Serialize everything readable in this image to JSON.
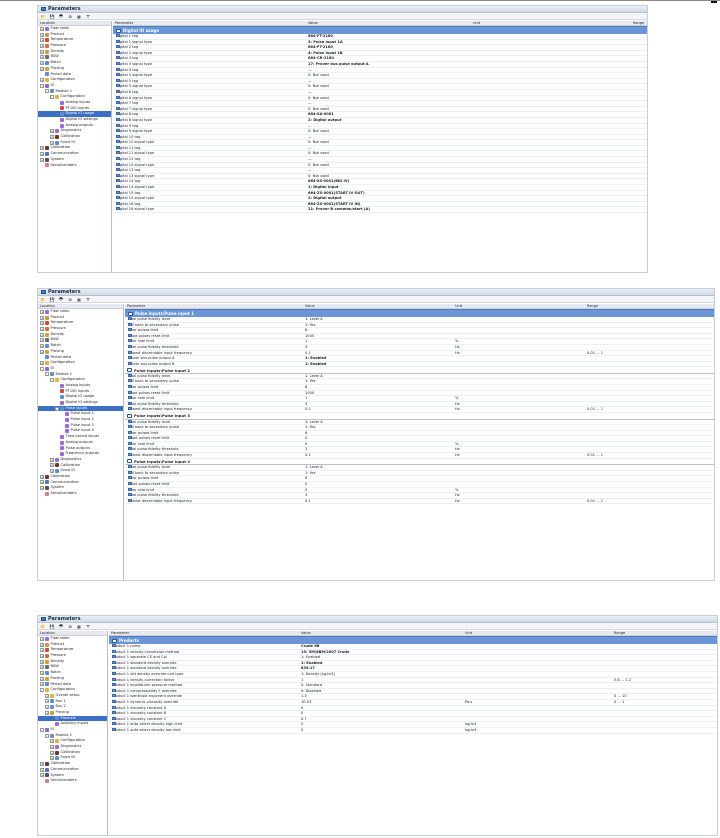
{
  "title": "Parameters",
  "left_header": "Location",
  "columns": {
    "parameter": "Parameter",
    "value": "Value",
    "unit": "Unit",
    "range": "Range"
  },
  "panel1": {
    "tree": [
      {
        "label": "Flow rates",
        "exp": "+",
        "color": "#9c6bd6"
      },
      {
        "label": "Product",
        "exp": "+",
        "color": "#c99a3d"
      },
      {
        "label": "Temperature",
        "exp": "+",
        "color": "#d04a3a"
      },
      {
        "label": "Pressure",
        "exp": "+",
        "color": "#d0703a"
      },
      {
        "label": "Density",
        "exp": "+",
        "color": "#c9a23d"
      },
      {
        "label": "BSW",
        "exp": "+",
        "color": "#6a6a6a"
      },
      {
        "label": "Batch",
        "exp": "+",
        "color": "#5b8fd0"
      },
      {
        "label": "Proving",
        "exp": "+",
        "color": "#c9a23d"
      },
      {
        "label": "Period data",
        "exp": "",
        "color": "#5b8fd0"
      },
      {
        "label": "Configuration",
        "exp": "+",
        "color": "#e0b040"
      },
      {
        "label": "IO",
        "exp": "-",
        "color": "#8b6bc9"
      },
      {
        "label": "Module 1",
        "exp": "-",
        "color": "#6b8fb0"
      },
      {
        "label": "Configuration",
        "exp": "-",
        "color": "#e0b040"
      },
      {
        "label": "Analog inputs",
        "exp": "",
        "color": "#9c6bd6"
      },
      {
        "label": "PT100 inputs",
        "exp": "",
        "color": "#d04a3a"
      },
      {
        "label": "Digital IO usage",
        "exp": "",
        "color": "#5b8fd0",
        "sel": true
      },
      {
        "label": "Digital IO settings",
        "exp": "",
        "color": "#9c6bd6"
      },
      {
        "label": "Analog outputs",
        "exp": "",
        "color": "#9c6bd6"
      },
      {
        "label": "Diagnostics",
        "exp": "+",
        "color": "#9c6bd6"
      },
      {
        "label": "Calibration",
        "exp": "+",
        "color": "#6a3a2a"
      },
      {
        "label": "Force IO",
        "exp": "+",
        "color": "#5b8fd0"
      },
      {
        "label": "Calibration",
        "exp": "+",
        "color": "#6a3a2a"
      },
      {
        "label": "Communication",
        "exp": "+",
        "color": "#4a7ab8"
      },
      {
        "label": "System",
        "exp": "+",
        "color": "#555"
      },
      {
        "label": "Serialnumbers",
        "exp": "",
        "color": "#d08080"
      }
    ],
    "section": "Digital IO usage",
    "rows": [
      {
        "p": "Digital 1 tag",
        "v": "664-FT-2180",
        "b": true
      },
      {
        "p": "Digital 1 signal type",
        "v": "3: Pulse input 1A",
        "b": true
      },
      {
        "p": "Digital 2 tag",
        "v": "664-FT-2180",
        "b": true
      },
      {
        "p": "Digital 2 signal type",
        "v": "4: Pulse input 1B",
        "b": true
      },
      {
        "p": "Digital 3 tag",
        "v": "664-CR-2180",
        "b": true
      },
      {
        "p": "Digital 3 signal type",
        "v": "17: Prover bus pulse output A",
        "b": true
      },
      {
        "p": "Digital 4 tag",
        "v": "—",
        "b": false
      },
      {
        "p": "Digital 4 signal type",
        "v": "0: Not used",
        "b": false
      },
      {
        "p": "Digital 5 tag",
        "v": "—",
        "b": false
      },
      {
        "p": "Digital 5 signal type",
        "v": "0: Not used",
        "b": false
      },
      {
        "p": "Digital 6 tag",
        "v": "—",
        "b": false
      },
      {
        "p": "Digital 6 signal type",
        "v": "0: Not used",
        "b": false
      },
      {
        "p": "Digital 7 tag",
        "v": "—",
        "b": false
      },
      {
        "p": "Digital 7 signal type",
        "v": "0: Not used",
        "b": false
      },
      {
        "p": "Digital 8 tag",
        "v": "664-XA-0001",
        "b": true
      },
      {
        "p": "Digital 8 signal type",
        "v": "2: Digital output",
        "b": true
      },
      {
        "p": "Digital 9 tag",
        "v": "—",
        "b": false
      },
      {
        "p": "Digital 9 signal type",
        "v": "0: Not used",
        "b": false
      },
      {
        "p": "Digital 10 tag",
        "v": "—",
        "b": false
      },
      {
        "p": "Digital 10 signal type",
        "v": "0: Not used",
        "b": false
      },
      {
        "p": "Digital 11 tag",
        "v": "—",
        "b": false
      },
      {
        "p": "Digital 11 signal type",
        "v": "0: Not used",
        "b": false
      },
      {
        "p": "Digital 12 tag",
        "v": "—",
        "b": false
      },
      {
        "p": "Digital 12 signal type",
        "v": "0: Not used",
        "b": false
      },
      {
        "p": "Digital 13 tag",
        "v": "—",
        "b": false
      },
      {
        "p": "Digital 13 signal type",
        "v": "0: Not used",
        "b": false
      },
      {
        "p": "Digital 14 tag",
        "v": "664-XS-0001(BDI IV)",
        "b": true
      },
      {
        "p": "Digital 14 signal type",
        "v": "1: Digital input",
        "b": true
      },
      {
        "p": "Digital 15 tag",
        "v": "664-ZS-0001(START IV OUT)",
        "b": true
      },
      {
        "p": "Digital 15 signal type",
        "v": "2: Digital output",
        "b": true
      },
      {
        "p": "Digital 16 tag",
        "v": "664-ZS-0001(START IV IN)",
        "b": true
      },
      {
        "p": "Digital 16 signal type",
        "v": "21: Prover B common/start (A)",
        "b": true
      }
    ]
  },
  "panel2": {
    "tree": [
      {
        "label": "Flow rates",
        "exp": "+",
        "color": "#9c6bd6"
      },
      {
        "label": "Product",
        "exp": "+",
        "color": "#c99a3d"
      },
      {
        "label": "Temperature",
        "exp": "+",
        "color": "#d04a3a"
      },
      {
        "label": "Pressure",
        "exp": "+",
        "color": "#d0703a"
      },
      {
        "label": "Density",
        "exp": "+",
        "color": "#c9a23d"
      },
      {
        "label": "BSW",
        "exp": "+",
        "color": "#6a6a6a"
      },
      {
        "label": "Batch",
        "exp": "+",
        "color": "#5b8fd0"
      },
      {
        "label": "Proving",
        "exp": "+",
        "color": "#c9a23d"
      },
      {
        "label": "Period data",
        "exp": "",
        "color": "#5b8fd0"
      },
      {
        "label": "Configuration",
        "exp": "+",
        "color": "#e0b040"
      },
      {
        "label": "IO",
        "exp": "-",
        "color": "#8b6bc9"
      },
      {
        "label": "Module 1",
        "exp": "-",
        "color": "#6b8fb0"
      },
      {
        "label": "Configuration",
        "exp": "-",
        "color": "#e0b040"
      },
      {
        "label": "Analog inputs",
        "exp": "",
        "color": "#9c6bd6"
      },
      {
        "label": "PT100 inputs",
        "exp": "",
        "color": "#d04a3a"
      },
      {
        "label": "Digital IO usage",
        "exp": "",
        "color": "#5b8fd0"
      },
      {
        "label": "Digital IO settings",
        "exp": "",
        "color": "#9c6bd6"
      },
      {
        "label": "Pulse inputs",
        "exp": "-",
        "color": "#5b8fd0",
        "sel": true
      },
      {
        "label": "Pulse input 1",
        "exp": "",
        "color": "#9c6bd6"
      },
      {
        "label": "Pulse input 2",
        "exp": "",
        "color": "#9c6bd6"
      },
      {
        "label": "Pulse input 3",
        "exp": "",
        "color": "#9c6bd6"
      },
      {
        "label": "Pulse input 4",
        "exp": "",
        "color": "#9c6bd6"
      },
      {
        "label": "Time period inputs",
        "exp": "",
        "color": "#9c6bd6"
      },
      {
        "label": "Analog outputs",
        "exp": "",
        "color": "#9c6bd6"
      },
      {
        "label": "Pulse outputs",
        "exp": "",
        "color": "#9c6bd6"
      },
      {
        "label": "Frequency outputs",
        "exp": "",
        "color": "#9c6bd6"
      },
      {
        "label": "Diagnostics",
        "exp": "+",
        "color": "#9c6bd6"
      },
      {
        "label": "Calibration",
        "exp": "+",
        "color": "#6a3a2a"
      },
      {
        "label": "Force IO",
        "exp": "+",
        "color": "#5b8fd0"
      },
      {
        "label": "Calibration",
        "exp": "+",
        "color": "#6a3a2a"
      },
      {
        "label": "Communication",
        "exp": "+",
        "color": "#4a7ab8"
      },
      {
        "label": "System",
        "exp": "+",
        "color": "#555"
      },
      {
        "label": "Serialnumbers",
        "exp": "",
        "color": "#d08080"
      }
    ],
    "section": "Pulse inputs\\Pulse input 1",
    "groups": [
      {
        "heading": "",
        "rows": [
          {
            "p": "Dual pulse fidelity level",
            "v": "1: Level A",
            "u": "",
            "r": ""
          },
          {
            "p": "Fall back to secondary pulse",
            "v": "1: Yes",
            "u": "",
            "r": ""
          },
          {
            "p": "Error pulses limit",
            "v": "6",
            "u": "",
            "r": ""
          },
          {
            "p": "Good pulses reset limit",
            "v": "1000",
            "u": "",
            "r": ""
          },
          {
            "p": "Error rate limit",
            "v": "1",
            "u": "%",
            "r": ""
          },
          {
            "p": "Dual pulse fidelity threshold",
            "v": "3",
            "u": "Hz",
            "r": ""
          },
          {
            "p": "Lowest discernable input frequency",
            "v": "0.1",
            "u": "Hz",
            "r": "0.01 ... 1"
          },
          {
            "p": "Prover bus pulse output A",
            "v": "1: Enabled",
            "u": "",
            "r": "",
            "b": true
          },
          {
            "p": "Prover bus pulse output B",
            "v": "1: Enabled",
            "u": "",
            "r": "",
            "b": true
          }
        ]
      },
      {
        "heading": "Pulse inputs\\Pulse input 2",
        "rows": [
          {
            "p": "Dual pulse fidelity level",
            "v": "1: Level A",
            "u": "",
            "r": ""
          },
          {
            "p": "Fall back to secondary pulse",
            "v": "1: Yes",
            "u": "",
            "r": ""
          },
          {
            "p": "Error pulses limit",
            "v": "6",
            "u": "",
            "r": ""
          },
          {
            "p": "Good pulses reset limit",
            "v": "1000",
            "u": "",
            "r": ""
          },
          {
            "p": "Error rate limit",
            "v": "1",
            "u": "%",
            "r": ""
          },
          {
            "p": "Dual pulse fidelity threshold",
            "v": "3",
            "u": "Hz",
            "r": ""
          },
          {
            "p": "Lowest discernable input frequency",
            "v": "0.1",
            "u": "Hz",
            "r": "0.01 ... 1"
          }
        ]
      },
      {
        "heading": "Pulse inputs\\Pulse input 3",
        "rows": [
          {
            "p": "Dual pulse fidelity level",
            "v": "1: Level A",
            "u": "",
            "r": ""
          },
          {
            "p": "Fall back to secondary pulse",
            "v": "1: Yes",
            "u": "",
            "r": ""
          },
          {
            "p": "Error pulses limit",
            "v": "6",
            "u": "",
            "r": ""
          },
          {
            "p": "Good pulses reset limit",
            "v": "0",
            "u": "",
            "r": ""
          },
          {
            "p": "Error rate limit",
            "v": "0",
            "u": "%",
            "r": ""
          },
          {
            "p": "Dual pulse fidelity threshold",
            "v": "3",
            "u": "Hz",
            "r": ""
          },
          {
            "p": "Lowest discernable input frequency",
            "v": "0.1",
            "u": "Hz",
            "r": "0.01 ... 1"
          }
        ]
      },
      {
        "heading": "Pulse inputs\\Pulse input 4",
        "rows": [
          {
            "p": "Dual pulse fidelity level",
            "v": "1: Level A",
            "u": "",
            "r": ""
          },
          {
            "p": "Fall back to secondary pulse",
            "v": "1: Yes",
            "u": "",
            "r": ""
          },
          {
            "p": "Error pulses limit",
            "v": "6",
            "u": "",
            "r": ""
          },
          {
            "p": "Good pulses reset limit",
            "v": "0",
            "u": "",
            "r": ""
          },
          {
            "p": "Error rate limit",
            "v": "0",
            "u": "%",
            "r": ""
          },
          {
            "p": "Dual pulse fidelity threshold",
            "v": "3",
            "u": "Hz",
            "r": ""
          },
          {
            "p": "Lowest discernable input frequency",
            "v": "0.1",
            "u": "Hz",
            "r": "0.01 ... 1"
          }
        ]
      }
    ]
  },
  "panel3": {
    "tree": [
      {
        "label": "Flow rates",
        "exp": "+",
        "color": "#9c6bd6"
      },
      {
        "label": "Product",
        "exp": "+",
        "color": "#c99a3d"
      },
      {
        "label": "Temperature",
        "exp": "+",
        "color": "#d04a3a"
      },
      {
        "label": "Pressure",
        "exp": "+",
        "color": "#d0703a"
      },
      {
        "label": "Density",
        "exp": "+",
        "color": "#c9a23d"
      },
      {
        "label": "BSW",
        "exp": "+",
        "color": "#6a6a6a"
      },
      {
        "label": "Batch",
        "exp": "+",
        "color": "#5b8fd0"
      },
      {
        "label": "Proving",
        "exp": "+",
        "color": "#c9a23d"
      },
      {
        "label": "Period data",
        "exp": "+",
        "color": "#5b8fd0"
      },
      {
        "label": "Configuration",
        "exp": "-",
        "color": "#e0b040"
      },
      {
        "label": "Overall setup",
        "exp": "+",
        "color": "#e0b040"
      },
      {
        "label": "Run 1",
        "exp": "+",
        "color": "#5b8fd0"
      },
      {
        "label": "Run 2",
        "exp": "+",
        "color": "#5b8fd0"
      },
      {
        "label": "Proving",
        "exp": "+",
        "color": "#c9a23d"
      },
      {
        "label": "Products",
        "exp": "",
        "color": "#5b8fd0",
        "sel": true
      },
      {
        "label": "Auxiliary inputs",
        "exp": "",
        "color": "#9c6bd6"
      },
      {
        "label": "IO",
        "exp": "-",
        "color": "#8b6bc9"
      },
      {
        "label": "Module 1",
        "exp": "-",
        "color": "#6b8fb0"
      },
      {
        "label": "Configuration",
        "exp": "+",
        "color": "#e0b040"
      },
      {
        "label": "Diagnostics",
        "exp": "+",
        "color": "#9c6bd6"
      },
      {
        "label": "Calibration",
        "exp": "+",
        "color": "#6a3a2a"
      },
      {
        "label": "Force IO",
        "exp": "+",
        "color": "#5b8fd0"
      },
      {
        "label": "Calibration",
        "exp": "+",
        "color": "#6a3a2a"
      },
      {
        "label": "Communication",
        "exp": "+",
        "color": "#4a7ab8"
      },
      {
        "label": "System",
        "exp": "+",
        "color": "#555"
      },
      {
        "label": "Serialnumbers",
        "exp": "",
        "color": "#d08080"
      }
    ],
    "section": "Products",
    "rows": [
      {
        "p": "Product 1 name",
        "v": "Crude 6B",
        "u": "",
        "r": "",
        "b": true
      },
      {
        "p": "Product 1 density conversion method",
        "v": "15: 5M/6BM/2007 Crude",
        "u": "",
        "r": "",
        "b": true
      },
      {
        "p": "Product 1 separate CS and Cpl",
        "v": "1: Enabled",
        "u": "",
        "r": ""
      },
      {
        "p": "Product 1 standard density override",
        "v": "1: Enabled",
        "u": "",
        "r": "",
        "b": true
      },
      {
        "p": "Product 1 standard density override",
        "v": "839.17",
        "u": "",
        "r": "",
        "b": true
      },
      {
        "p": "Product 1 std density override unit type",
        "v": "1: Density [kg/m3]",
        "u": "",
        "r": ""
      },
      {
        "p": "Product 1 density correction factor",
        "v": "1",
        "u": "",
        "r": "0.8 ... 1.2"
      },
      {
        "p": "Product 1 equilibrium pressure method",
        "v": "2: Standard",
        "u": "",
        "r": ""
      },
      {
        "p": "Product 1 compressibility F override",
        "v": "0: Disabled",
        "u": "",
        "r": ""
      },
      {
        "p": "Product 1 isentropic exponent override",
        "v": "1.3",
        "u": "",
        "r": "0 ... 10"
      },
      {
        "p": "Product 1 dynamic viscosity override",
        "v": "1E-03",
        "u": "Pa.s",
        "r": "0 ... 1"
      },
      {
        "p": "Product 1 viscosity constant A",
        "v": "0",
        "u": "",
        "r": ""
      },
      {
        "p": "Product 1 viscosity constant B",
        "v": "0",
        "u": "",
        "r": ""
      },
      {
        "p": "Product 1 viscosity constant C",
        "v": "0.7",
        "u": "",
        "r": ""
      },
      {
        "p": "Product 1 auto select density high limit",
        "v": "0",
        "u": "kg/m3",
        "r": ""
      },
      {
        "p": "Product 1 auto select density low limit",
        "v": "0",
        "u": "kg/m3",
        "r": ""
      }
    ]
  }
}
